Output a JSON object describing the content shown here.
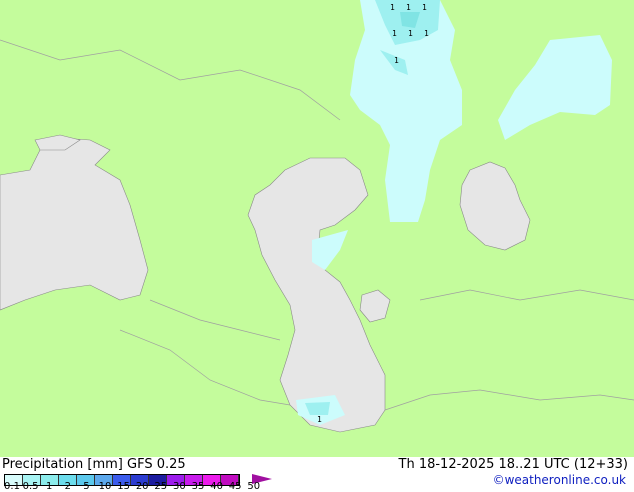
{
  "map": {
    "colors": {
      "land": "#c4fc9c",
      "sea": "#e6e6e6",
      "precip_light": "#ccfcfc",
      "precip_mid": "#9ef0f0",
      "precip_heavy": "#80e4e4",
      "border": "#a0a0a0"
    }
  },
  "legend": {
    "title": "Precipitation [mm]  GFS 0.25",
    "valid_time": "Th 18-12-2025 18..21 UTC (12+33)",
    "credit": "©weatheronline.co.uk",
    "scale_colors": [
      "#d8fcfc",
      "#a8f4f4",
      "#8cecec",
      "#6cdcec",
      "#5cc8ec",
      "#5ca8ec",
      "#3c5cec",
      "#2c3cd0",
      "#1c1ca0",
      "#9c1cec",
      "#c81cec",
      "#ec1cec",
      "#c00cc0",
      "#a010a0"
    ],
    "scale_labels": [
      "0.1",
      "0.5",
      "1",
      "2",
      "5",
      "10",
      "15",
      "20",
      "25",
      "30",
      "35",
      "40",
      "45",
      "50"
    ]
  }
}
